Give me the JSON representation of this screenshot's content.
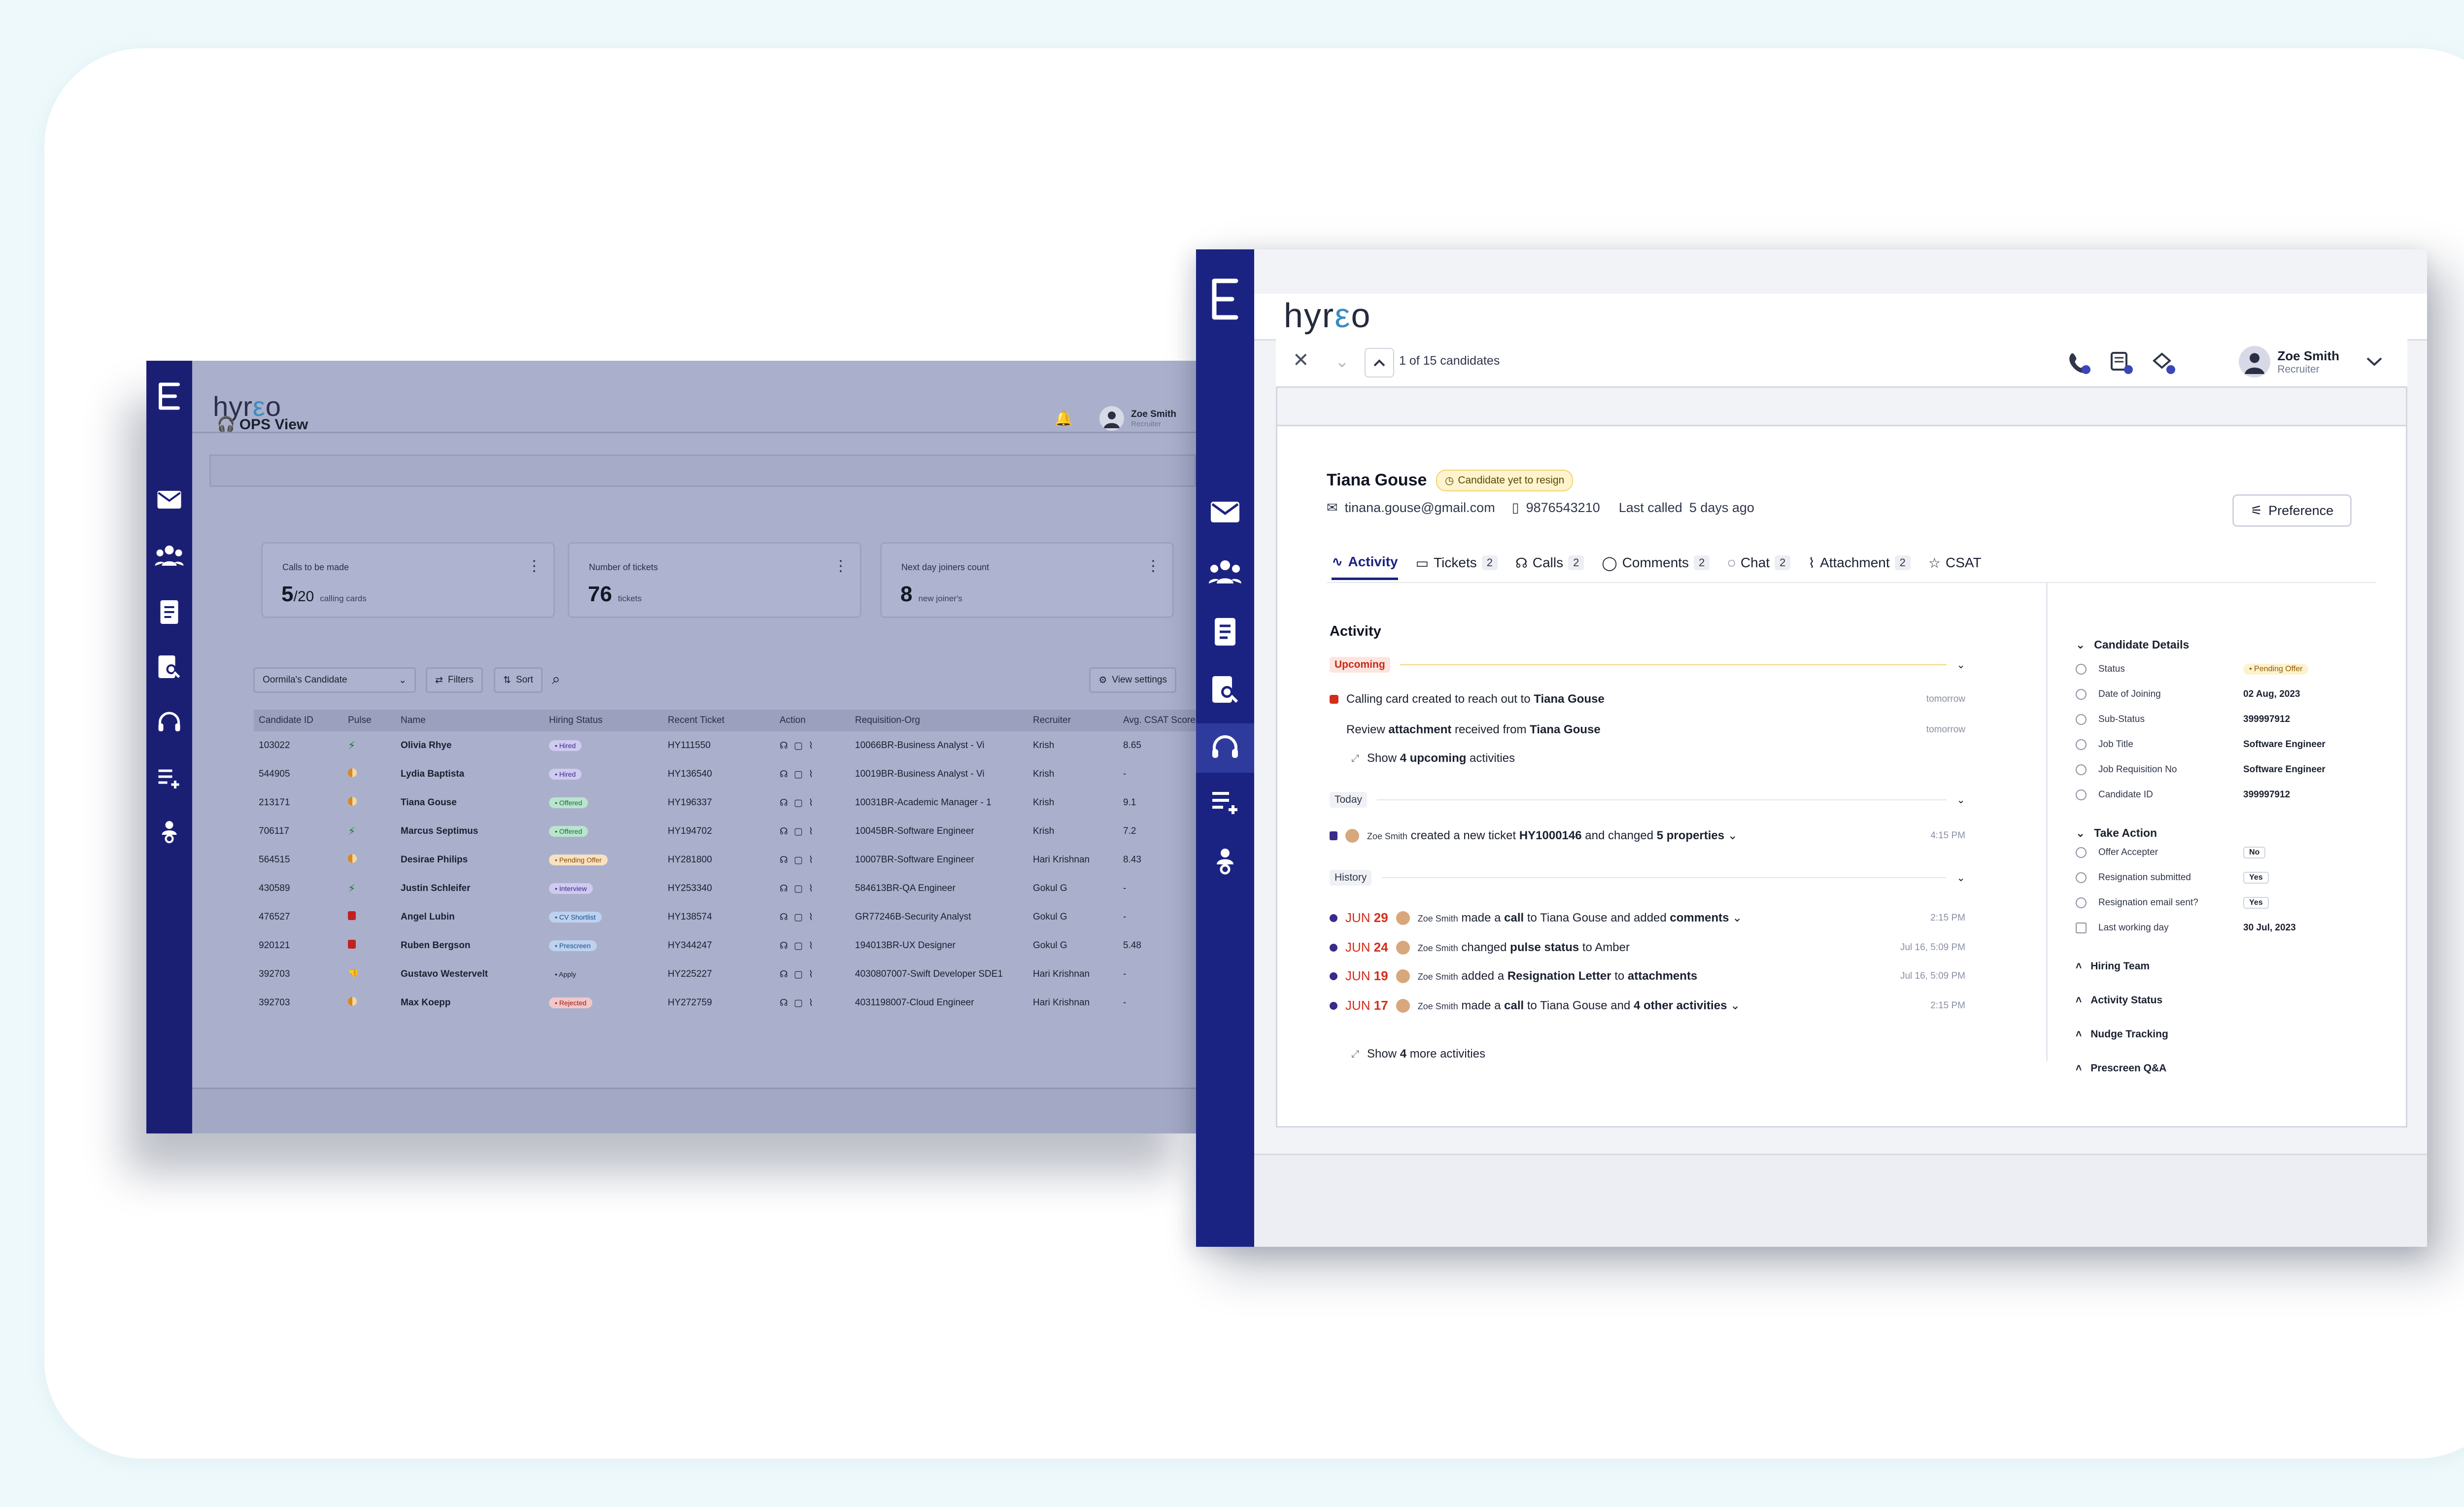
{
  "colors": {
    "rail_dark": "#1b2382",
    "accent_blue": "#3a8cc0",
    "upcoming_red": "#d42d1c",
    "pending": "#fff1cf"
  },
  "ops": {
    "brand": "hyreo",
    "page_title": "OPS View",
    "user": {
      "name": "Zoe Smith",
      "role": "Recruiter"
    },
    "kpis": [
      {
        "title": "Calls to be made",
        "value": "5",
        "denom": "/20",
        "unit": "calling cards"
      },
      {
        "title": "Number of tickets",
        "value": "76",
        "denom": "",
        "unit": "tickets"
      },
      {
        "title": "Next day joiners count",
        "value": "8",
        "denom": "",
        "unit": "new joiner's"
      }
    ],
    "controls": {
      "dropdown": "Oormila's Candidate",
      "filters": "Filters",
      "sort": "Sort",
      "view_settings": "View settings"
    },
    "columns": [
      "Candidate ID",
      "Pulse",
      "Name",
      "Hiring Status",
      "Recent Ticket",
      "Action",
      "Requisition-Org",
      "Recruiter",
      "Avg. CSAT Score"
    ],
    "rows": [
      {
        "id": "103022",
        "name": "Olivia Rhye",
        "status": "Hired",
        "ticket": "HY111550",
        "req": "10066BR-Business Analyst - Vi",
        "recruiter": "Krish",
        "csat": "8.65"
      },
      {
        "id": "544905",
        "name": "Lydia Baptista",
        "status": "Hired",
        "ticket": "HY136540",
        "req": "10019BR-Business Analyst - Vi",
        "recruiter": "Krish",
        "csat": "-"
      },
      {
        "id": "213171",
        "name": "Tiana Gouse",
        "status": "Offered",
        "ticket": "HY196337",
        "req": "10031BR-Academic Manager - 1",
        "recruiter": "Krish",
        "csat": "9.1"
      },
      {
        "id": "706117",
        "name": "Marcus Septimus",
        "status": "Offered",
        "ticket": "HY194702",
        "req": "10045BR-Software Engineer",
        "recruiter": "Krish",
        "csat": "7.2"
      },
      {
        "id": "564515",
        "name": "Desirae Philips",
        "status": "Pending Offer",
        "ticket": "HY281800",
        "req": "10007BR-Software Engineer",
        "recruiter": "Hari Krishnan",
        "csat": "8.43"
      },
      {
        "id": "430589",
        "name": "Justin Schleifer",
        "status": "Interview",
        "ticket": "HY253340",
        "req": "584613BR-QA Engineer",
        "recruiter": "Gokul G",
        "csat": "-"
      },
      {
        "id": "476527",
        "name": "Angel Lubin",
        "status": "CV Shortlist",
        "ticket": "HY138574",
        "req": "GR77246B-Security Analyst",
        "recruiter": "Gokul G",
        "csat": "-"
      },
      {
        "id": "920121",
        "name": "Ruben Bergson",
        "status": "Prescreen",
        "ticket": "HY344247",
        "req": "194013BR-UX Designer",
        "recruiter": "Gokul G",
        "csat": "5.48"
      },
      {
        "id": "392703",
        "name": "Gustavo Westervelt",
        "status": "Apply",
        "ticket": "HY225227",
        "req": "4030807007-Swift Developer SDE1",
        "recruiter": "Hari Krishnan",
        "csat": "-"
      },
      {
        "id": "392703",
        "name": "Max Koepp",
        "status": "Rejected",
        "ticket": "HY272759",
        "req": "4031198007-Cloud Engineer",
        "recruiter": "Hari Krishnan",
        "csat": "-"
      }
    ]
  },
  "detail": {
    "brand": "hyreo",
    "nav": {
      "count_text": "1 of 15 candidates"
    },
    "user": {
      "name": "Zoe Smith",
      "role": "Recruiter"
    },
    "candidate": {
      "name": "Tiana Gouse",
      "badge": "Candidate yet to resign",
      "email": "tinana.gouse@gmail.com",
      "phone": "9876543210",
      "last_called_label": "Last called",
      "last_called_value": "5 days ago"
    },
    "preference": "Preference",
    "tabs": [
      {
        "label": "Activity",
        "count": ""
      },
      {
        "label": "Tickets",
        "count": "2"
      },
      {
        "label": "Calls",
        "count": "2"
      },
      {
        "label": "Comments",
        "count": "2"
      },
      {
        "label": "Chat",
        "count": "2"
      },
      {
        "label": "Attachment",
        "count": "2"
      },
      {
        "label": "CSAT",
        "count": ""
      }
    ],
    "activity": {
      "title": "Activity",
      "upcoming_label": "Upcoming",
      "upcoming": [
        {
          "pre": "Calling card created to reach out to ",
          "bold": "Tiana Gouse",
          "post": "",
          "time": "tomorrow"
        },
        {
          "pre": "Review ",
          "bold": "attachment",
          "mid": " received from ",
          "bold2": "Tiana Gouse",
          "time": "tomorrow"
        }
      ],
      "show_upcoming": {
        "pre": "Show ",
        "num": "4",
        "b": "upcoming",
        "post": " activities"
      },
      "today_label": "Today",
      "today": {
        "who": "Zoe Smith",
        "pre": " created a new ticket ",
        "b1": "HY1000146",
        "mid": " and changed ",
        "b2": "5 properties",
        "time": "4:15 PM"
      },
      "history_label": "History",
      "history": [
        {
          "month": "JUN",
          "day": "29",
          "who": "Zoe Smith",
          "pre": " made a ",
          "b1": "call",
          "mid": " to Tiana Gouse and added ",
          "b2": "comments",
          "time": "2:15 PM"
        },
        {
          "month": "JUN",
          "day": "24",
          "who": "Zoe Smith",
          "pre": " changed ",
          "b1": "pulse status",
          "mid": " to Amber",
          "b2": "",
          "time": "Jul 16, 5:09 PM"
        },
        {
          "month": "JUN",
          "day": "19",
          "who": "Zoe Smith",
          "pre": " added a ",
          "b1": "Resignation Letter",
          "mid": " to ",
          "b2": "attachments",
          "time": "Jul 16, 5:09 PM"
        },
        {
          "month": "JUN",
          "day": "17",
          "who": "Zoe Smith",
          "pre": " made a ",
          "b1": "call",
          "mid": " to Tiana Gouse and ",
          "b2": "4 other activities",
          "time": "2:15 PM"
        }
      ],
      "show_more": {
        "pre": "Show ",
        "num": "4",
        "post": " more activities"
      }
    },
    "details": {
      "title": "Candidate Details",
      "fields": [
        {
          "label": "Status",
          "value": "Pending Offer"
        },
        {
          "label": "Date of Joining",
          "value": "02 Aug, 2023"
        },
        {
          "label": "Sub-Status",
          "value": "399997912"
        },
        {
          "label": "Job Title",
          "value": "Software Engineer"
        },
        {
          "label": "Job Requisition No",
          "value": "Software Engineer"
        },
        {
          "label": "Candidate ID",
          "value": "399997912"
        }
      ],
      "take_action": "Take Action",
      "actions": [
        {
          "label": "Offer Accepter",
          "value": "No"
        },
        {
          "label": "Resignation submitted",
          "value": "Yes"
        },
        {
          "label": "Resignation email sent?",
          "value": "Yes"
        },
        {
          "label": "Last working day",
          "value": "30 Jul, 2023"
        }
      ],
      "sections": [
        "Hiring Team",
        "Activity Status",
        "Nudge Tracking",
        "Prescreen Q&A"
      ]
    }
  }
}
